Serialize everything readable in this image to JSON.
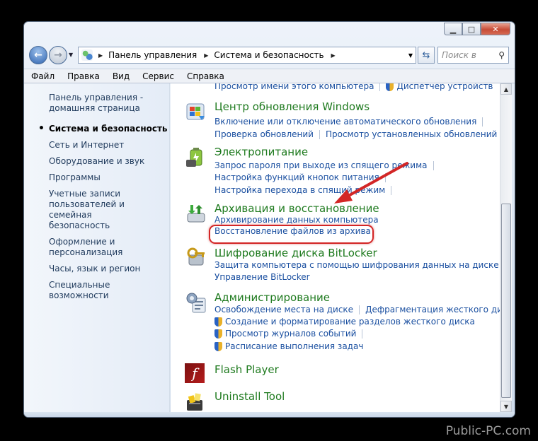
{
  "address": {
    "seg1": "Панель управления",
    "seg2": "Система и безопасность"
  },
  "search": {
    "placeholder": "Поиск в"
  },
  "menu": {
    "file": "Файл",
    "edit": "Правка",
    "view": "Вид",
    "service": "Сервис",
    "help": "Справка"
  },
  "sidebar": {
    "items": [
      {
        "label": "Панель управления -\nдомашняя страница"
      },
      {
        "label": "Система и безопасность"
      },
      {
        "label": "Сеть и Интернет"
      },
      {
        "label": "Оборудование и звук"
      },
      {
        "label": "Программы"
      },
      {
        "label": "Учетные записи\nпользователей и семейная\nбезопасность"
      },
      {
        "label": "Оформление и\nперсонализация"
      },
      {
        "label": "Часы, язык и регион"
      },
      {
        "label": "Специальные возможности"
      }
    ]
  },
  "top_links": {
    "link1": "Просмотр имени этого компьютера",
    "link2": "Диспетчер устройств"
  },
  "windows_update": {
    "title": "Центр обновления Windows",
    "l1": "Включение или отключение автоматического обновления",
    "l2": "Проверка обновлений",
    "l3": "Просмотр установленных обновлений"
  },
  "power": {
    "title": "Электропитание",
    "l1": "Запрос пароля при выходе из спящего режима",
    "l2": "Настройка функций кнопок питания",
    "l3": "Настройка перехода в спящий режим"
  },
  "backup": {
    "title": "Архивация и восстановление",
    "l1": "Архивирование данных компьютера",
    "l2": "Восстановление файлов из архива"
  },
  "bitlocker": {
    "title": "Шифрование диска BitLocker",
    "l1": "Защита компьютера с помощью шифрования данных на диске",
    "l2": "Управление BitLocker"
  },
  "admin": {
    "title": "Администрирование",
    "l1": "Освобождение места на диске",
    "l2": "Дефрагментация жесткого диска",
    "l3": "Создание и форматирование разделов жесткого диска",
    "l4": "Просмотр журналов событий",
    "l5": "Расписание выполнения задач"
  },
  "flash": {
    "title": "Flash Player"
  },
  "uninstall": {
    "title": "Uninstall Tool"
  },
  "watermark": "Public-PC.com",
  "colors": {
    "category_title": "#1e7a1e",
    "link": "#1a4fa0",
    "highlight": "#d32626"
  }
}
